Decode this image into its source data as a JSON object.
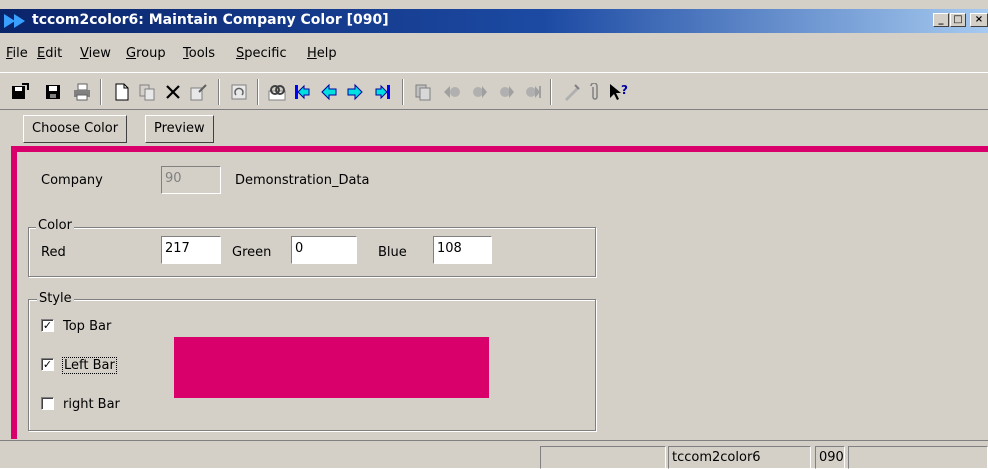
{
  "window": {
    "title": "tccom2color6: Maintain Company Color [090]",
    "minimize": "_",
    "maximize": "□",
    "close": "×"
  },
  "menu": {
    "file": {
      "key": "F",
      "rest": "ile"
    },
    "edit": {
      "key": "E",
      "rest": "dit"
    },
    "view": {
      "key": "V",
      "rest": "iew"
    },
    "group": {
      "key": "G",
      "rest": "roup"
    },
    "tools": {
      "key": "T",
      "rest": "ools"
    },
    "specific": {
      "key": "S",
      "rest": "pecific"
    },
    "help": {
      "key": "H",
      "rest": "elp"
    }
  },
  "toolbar": {
    "icons": [
      "save-and-exit-icon",
      "save-icon",
      "print-icon",
      "new-icon",
      "duplicate-icon",
      "delete-icon",
      "edit-icon",
      "refresh-icon",
      "find-icon",
      "first-record-icon",
      "previous-record-icon",
      "next-record-icon",
      "last-record-icon",
      "group-first-icon",
      "group-previous-icon",
      "group-next-icon",
      "group-last-icon",
      "group-extra-icon",
      "attachment-icon",
      "help-icon"
    ],
    "accent": "#0000ff"
  },
  "tabs": {
    "choose_color": "Choose Color",
    "preview": "Preview"
  },
  "form": {
    "company_label": "Company",
    "company_value": "90",
    "company_description": "Demonstration_Data",
    "color_group": "Color",
    "red_label": "Red",
    "red_value": "217",
    "green_label": "Green",
    "green_value": "0",
    "blue_label": "Blue",
    "blue_value": "108",
    "style_group": "Style",
    "top_bar_label": "Top Bar",
    "top_bar_checked": true,
    "left_bar_label": "Left Bar",
    "left_bar_checked": true,
    "right_bar_label": "right Bar",
    "right_bar_checked": false,
    "preview_color": "#da006c"
  },
  "status": {
    "session": "tccom2color6",
    "company": "090"
  }
}
